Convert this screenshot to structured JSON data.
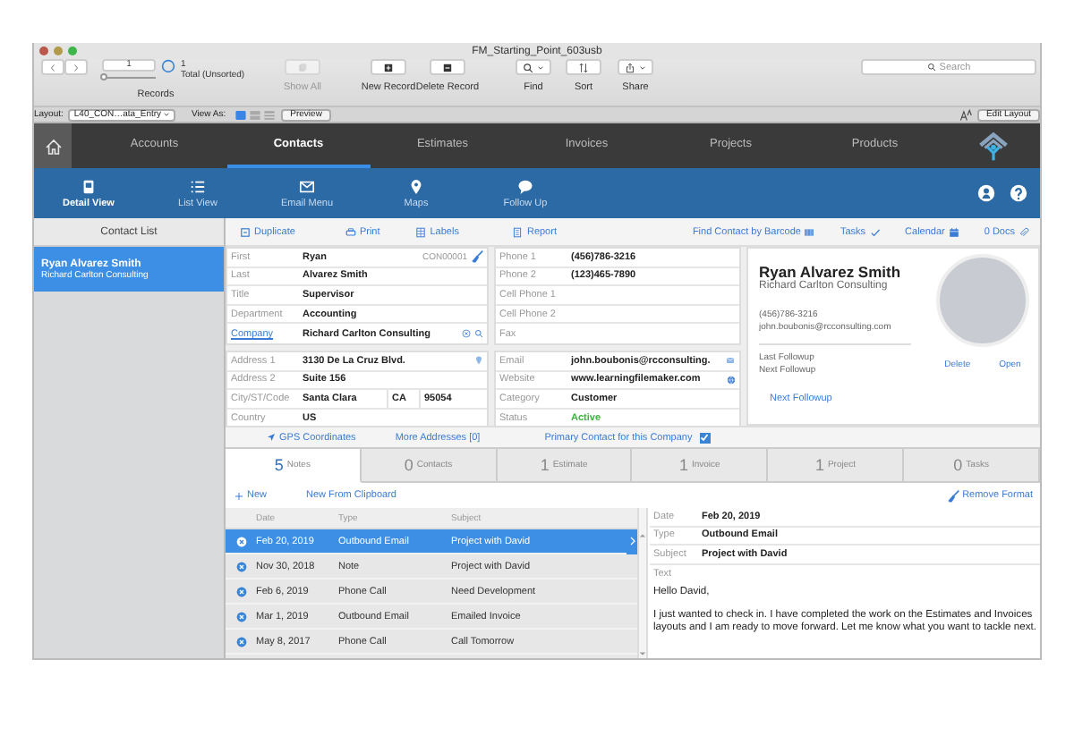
{
  "window": {
    "title": "FM_Starting_Point_603usb"
  },
  "toolbar": {
    "slider": {
      "level": 0
    },
    "record_field": "1",
    "record_count": "1",
    "sort_status": "Total (Unsorted)",
    "records_label": "Records",
    "buttons": [
      {
        "label": "Show All",
        "kind": "show_all",
        "disabled": true
      },
      {
        "label": "New Record",
        "kind": "new",
        "disabled": false
      },
      {
        "label": "Delete Record",
        "kind": "delete",
        "disabled": false
      },
      {
        "label": "Find",
        "kind": "find",
        "disabled": false
      },
      {
        "label": "Sort",
        "kind": "sort",
        "disabled": false
      },
      {
        "label": "Share",
        "kind": "share",
        "disabled": false
      }
    ],
    "search": {
      "placeholder": "Search"
    }
  },
  "layout_bar": {
    "layout_label": "Layout:",
    "layout_value": "L40_CON…ata_Entry",
    "view_as_label": "View As:",
    "view_modes": [
      {
        "kind": "form",
        "selected": true
      },
      {
        "kind": "list",
        "selected": false
      },
      {
        "kind": "table",
        "selected": false
      }
    ],
    "preview": "Preview",
    "edit_layout": "Edit Layout"
  },
  "nav_tabs": [
    {
      "label": "Accounts",
      "selected": false
    },
    {
      "label": "Contacts",
      "selected": true
    },
    {
      "label": "Estimates",
      "selected": false
    },
    {
      "label": "Invoices",
      "selected": false
    },
    {
      "label": "Projects",
      "selected": false
    },
    {
      "label": "Products",
      "selected": false
    }
  ],
  "sub_nav": [
    {
      "label": "Detail View",
      "kind": "detail",
      "selected": true
    },
    {
      "label": "List View",
      "kind": "list",
      "selected": false
    },
    {
      "label": "Email Menu",
      "kind": "email",
      "selected": false
    },
    {
      "label": "Maps",
      "kind": "maps",
      "selected": false
    },
    {
      "label": "Follow Up",
      "kind": "followup",
      "selected": false
    }
  ],
  "sidebar": {
    "title": "Contact List",
    "items": [
      {
        "name": "Ryan Alvarez Smith",
        "company": "Richard Carlton Consulting",
        "selected": true
      }
    ]
  },
  "actions": {
    "left": [
      {
        "label": "Duplicate",
        "kind": "duplicate"
      },
      {
        "label": "Print",
        "kind": "print"
      },
      {
        "label": "Labels",
        "kind": "labels"
      },
      {
        "label": "Report",
        "kind": "report"
      }
    ],
    "right": [
      {
        "label": "Find Contact by Barcode",
        "kind": "barcode"
      },
      {
        "label": "Tasks",
        "kind": "tasks"
      },
      {
        "label": "Calendar",
        "kind": "calendar"
      },
      {
        "label": "0 Docs",
        "kind": "docs"
      }
    ]
  },
  "contact_fields": [
    {
      "label": "First",
      "value": "Ryan",
      "kind": "id",
      "record_id": "CON00001"
    },
    {
      "label": "Last",
      "value": "Alvarez Smith",
      "kind": "plain"
    },
    {
      "label": "Title",
      "value": "Supervisor",
      "kind": "plain"
    },
    {
      "label": "Department",
      "value": "Accounting",
      "kind": "plain"
    },
    {
      "label": "Company",
      "value": "Richard Carlton Consulting",
      "kind": "company"
    }
  ],
  "address_fields": [
    {
      "label": "Address 1",
      "value": "3130 De La Cruz Blvd.",
      "kind": "address"
    },
    {
      "label": "Address 2",
      "value": "Suite 156",
      "kind": "plain"
    },
    {
      "label": "City/ST/Code",
      "value": "Santa Clara",
      "kind": "city",
      "extra": [
        "CA",
        "95054"
      ]
    },
    {
      "label": "Country",
      "value": "US",
      "kind": "plain"
    }
  ],
  "phone_fields": [
    {
      "label": "Phone 1",
      "value": "(456)786-3216",
      "kind": "plain"
    },
    {
      "label": "Phone 2",
      "value": "(123)465-7890",
      "kind": "plain"
    },
    {
      "label": "Cell Phone 1",
      "kind": "plain"
    },
    {
      "label": "Cell Phone 2",
      "kind": "plain"
    },
    {
      "label": "Fax",
      "kind": "plain"
    }
  ],
  "web_fields": [
    {
      "label": "Email",
      "value": "john.boubonis@rcconsulting.",
      "kind": "email"
    },
    {
      "label": "Website",
      "value": "www.learningfilemaker.com",
      "kind": "web"
    },
    {
      "label": "Category",
      "value": "Customer",
      "kind": "plain"
    },
    {
      "label": "Status",
      "value": "Active",
      "kind": "status"
    }
  ],
  "card": {
    "name": "Ryan Alvarez Smith",
    "company": "Richard Carlton Consulting",
    "phone": "(456)786-3216",
    "email": "john.boubonis@rcconsulting.com",
    "last_followup": "Last Followup",
    "next_followup": "Next Followup",
    "next_followup_link": "Next Followup",
    "delete": "Delete",
    "open": "Open"
  },
  "links": {
    "gps": "GPS Coordinates",
    "more_addresses": "More Addresses [0]",
    "primary_label": "Primary Contact for this Company",
    "primary_checked": true
  },
  "related_tabs": [
    {
      "count": "5",
      "label": "Notes",
      "selected": true
    },
    {
      "count": "0",
      "label": "Contacts",
      "selected": false
    },
    {
      "count": "1",
      "label": "Estimate",
      "selected": false
    },
    {
      "count": "1",
      "label": "Invoice",
      "selected": false
    },
    {
      "count": "1",
      "label": "Project",
      "selected": false
    },
    {
      "count": "0",
      "label": "Tasks",
      "selected": false
    }
  ],
  "notes_toolbar": {
    "new": "New",
    "new_from_clipboard": "New From Clipboard",
    "remove_format": "Remove Format"
  },
  "notes_table": {
    "columns": [
      "Date",
      "Type",
      "Subject"
    ],
    "rows": [
      {
        "cells": [
          "Feb 20, 2019",
          "Outbound Email",
          "Project with David"
        ],
        "selected": true
      },
      {
        "cells": [
          "Nov 30, 2018",
          "Note",
          "Project with David"
        ],
        "selected": false
      },
      {
        "cells": [
          "Feb 6, 2019",
          "Phone Call",
          "Need Development"
        ],
        "selected": false
      },
      {
        "cells": [
          "Mar 1, 2019",
          "Outbound Email",
          "Emailed Invoice"
        ],
        "selected": false
      },
      {
        "cells": [
          "May 8, 2017",
          "Phone Call",
          "Call Tomorrow"
        ],
        "selected": false
      }
    ]
  },
  "note_detail": {
    "fields": [
      {
        "label": "Date",
        "value": "Feb 20, 2019"
      },
      {
        "label": "Type",
        "value": "Outbound Email"
      },
      {
        "label": "Subject",
        "value": "Project with David"
      }
    ],
    "text_label": "Text",
    "paragraphs": [
      "Hello David,",
      "I just wanted to check in. I have completed the work on the Estimates and Invoices layouts and I am ready to move forward.  Let me know what you want to tackle next."
    ]
  }
}
